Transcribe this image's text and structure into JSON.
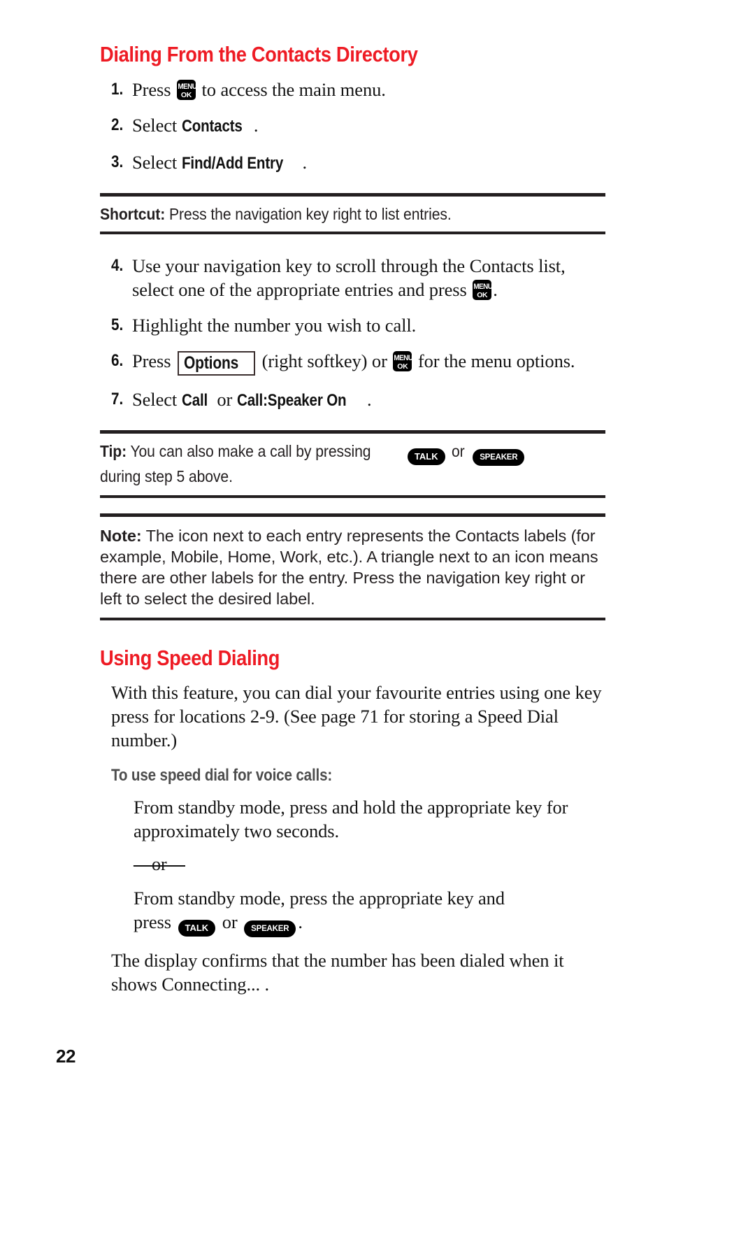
{
  "document": {
    "page_number": "22",
    "accent_color": "#ee1b24",
    "rule_color": "#231f20",
    "subhead_color": "#4d4d4d"
  },
  "section1": {
    "heading": "Dialing From the Contacts Directory",
    "steps": [
      {
        "num": "1.",
        "pre": "Press",
        "key": "menu-ok-key",
        "post": "to access the main menu."
      },
      {
        "num": "2.",
        "pre": "Select",
        "emphasis": "Contacts",
        "post": "."
      },
      {
        "num": "3.",
        "pre": "Select",
        "emphasis": "Find/Add Entry",
        "post": "."
      }
    ],
    "shortcut": {
      "label": "Shortcut:",
      "text": "Press the navigation key right to list entries."
    },
    "steps2": [
      {
        "num": "4.",
        "line1": "Use your navigation key to scroll through the Contacts list,",
        "line2_pre": "select one of the appropriate entries and press",
        "key": "menu-ok-key",
        "line2_post": "."
      },
      {
        "num": "5.",
        "text": "Highlight the number you wish to call."
      },
      {
        "num": "6.",
        "pre": "Press",
        "softkey": "Options",
        "mid": "(right softkey) or",
        "key": "menu-ok-key",
        "post": "for the menu options."
      },
      {
        "num": "7.",
        "pre": "Select",
        "emphasis1": "Call",
        "mid": "or",
        "emphasis2": "Call:Speaker On",
        "post": "."
      }
    ],
    "tip": {
      "label": "Tip:",
      "text_before": "You can also make a call by pressing",
      "key1": "TALK",
      "text_mid": "or",
      "key2": "SPEAKER",
      "text_after": "during step 5 above."
    },
    "note": {
      "label": "Note:",
      "text": "The icon next to each entry represents the Contacts labels (for example, Mobile, Home, Work, etc.). A triangle next to an icon means there are other labels for the entry. Press the navigation key right or left to select the desired label."
    }
  },
  "section2": {
    "heading": "Using Speed Dialing",
    "intro": "With this feature, you can dial your favourite entries using one key press for locations 2-9. (See page 71 for storing a Speed Dial number.)",
    "subhead": "To use speed dial for voice calls:",
    "method1": "From standby mode, press and hold the appropriate key for approximately two seconds.",
    "or_divider": "—or—",
    "method2_line1": "From standby mode, press the appropriate key and",
    "method2_pre": "press",
    "method2_key1": "TALK",
    "method2_mid": "or",
    "method2_key2": "SPEAKER",
    "method2_post": ".",
    "closing": "The display confirms that the number has been dialed when it shows  Connecting... ."
  },
  "keys": {
    "menu_line1": "MENU",
    "menu_line2": "OK",
    "talk": "TALK",
    "speaker": "SPEAKER"
  }
}
